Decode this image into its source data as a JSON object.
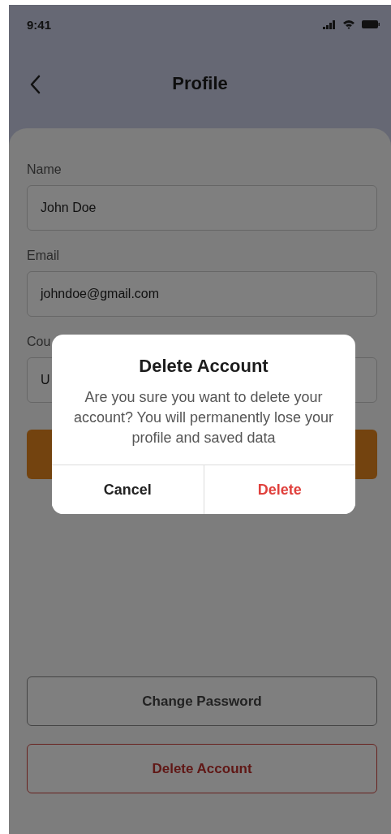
{
  "status_bar": {
    "time": "9:41"
  },
  "header": {
    "title": "Profile"
  },
  "form": {
    "fields": [
      {
        "label": "Name",
        "value": "John Doe"
      },
      {
        "label": "Email",
        "value": "johndoe@gmail.com"
      },
      {
        "label": "Cou",
        "value": "U"
      }
    ]
  },
  "buttons": [
    {
      "label": "Change Password",
      "kind": "outline"
    },
    {
      "label": "Delete Account",
      "kind": "danger"
    }
  ],
  "dialog": {
    "title": "Delete Account",
    "message": "Are you sure you want to delete your account? You will permanently lose your profile and saved data",
    "actions": [
      {
        "label": "Cancel",
        "kind": "cancel"
      },
      {
        "label": "Delete",
        "kind": "destructive"
      }
    ]
  }
}
